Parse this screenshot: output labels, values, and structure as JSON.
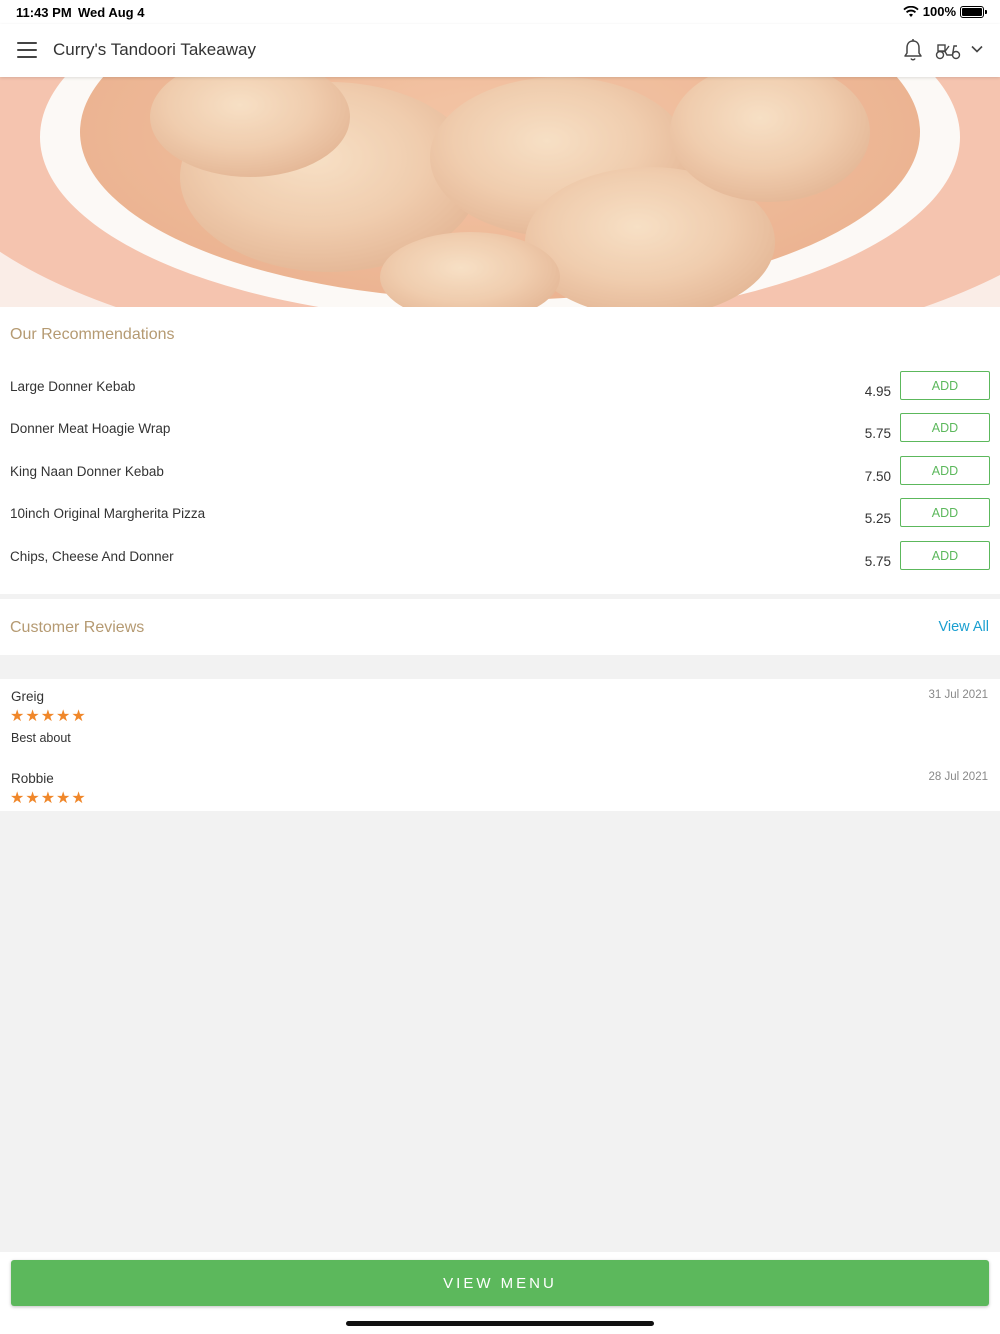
{
  "status_bar": {
    "time": "11:43 PM",
    "date": "Wed Aug 4",
    "battery": "100%",
    "battery_level": 1.0
  },
  "header": {
    "title": "Curry's Tandoori Takeaway",
    "icons": [
      "menu-icon",
      "bell-icon",
      "delivery-scooter-icon",
      "chevron-down-icon"
    ]
  },
  "hero": {
    "icon": "curry-dish-photo"
  },
  "recommendations": {
    "title": "Our Recommendations",
    "items": [
      {
        "name": "Large Donner Kebab",
        "price": "4.95",
        "button": "ADD"
      },
      {
        "name": "Donner Meat Hoagie Wrap",
        "price": "5.75",
        "button": "ADD"
      },
      {
        "name": "King Naan Donner Kebab",
        "price": "7.50",
        "button": "ADD"
      },
      {
        "name": "10inch Original Margherita Pizza",
        "price": "5.25",
        "button": "ADD"
      },
      {
        "name": "Chips, Cheese And Donner",
        "price": "5.75",
        "button": "ADD"
      }
    ]
  },
  "reviews": {
    "title": "Customer Reviews",
    "view_all": "View All",
    "items": [
      {
        "name": "Greig",
        "date": "31 Jul 2021",
        "rating": 5,
        "text": "Best about"
      },
      {
        "name": "Robbie",
        "date": "28 Jul 2021",
        "rating": 5,
        "text": ""
      }
    ]
  },
  "footer": {
    "button": "VIEW MENU"
  },
  "colors": {
    "accent_green": "#5cb85c",
    "section_title": "#b59a72",
    "link_blue": "#1a9fd0",
    "star_orange": "#f0872a"
  }
}
